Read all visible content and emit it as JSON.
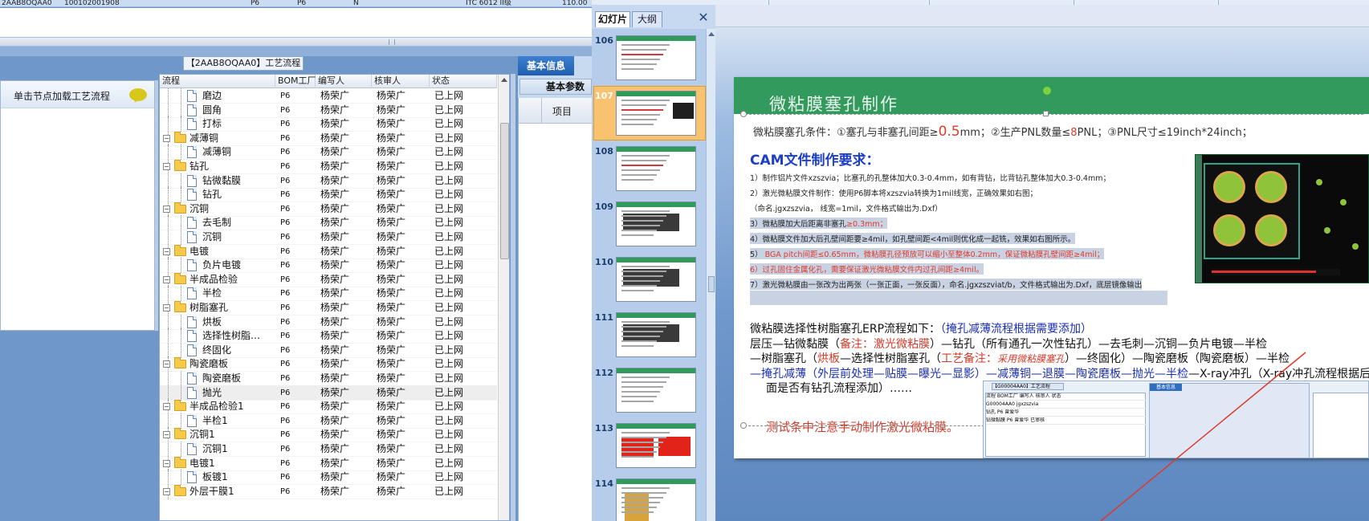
{
  "top_row": {
    "col1": "2AAB8OQAA0",
    "col2": "100102001908",
    "col3": "P6",
    "col4": "P6",
    "col5": "N",
    "col6": "ITC 6012 II级",
    "col7": "110.00"
  },
  "erp": {
    "load_hint": "单击节点加载工艺流程",
    "flow_title": "【2AAB8OQAA0】工艺流程",
    "columns": [
      "流程",
      "BOM工厂",
      "编写人",
      "核审人",
      "状态"
    ],
    "rows": [
      {
        "name": "磨边",
        "type": "doc",
        "plant": "P6",
        "author": "杨荣广",
        "reviewer": "杨荣广",
        "status": "已上网"
      },
      {
        "name": "圆角",
        "type": "doc",
        "plant": "P6",
        "author": "杨荣广",
        "reviewer": "杨荣广",
        "status": "已上网"
      },
      {
        "name": "打标",
        "type": "doc",
        "plant": "P6",
        "author": "杨荣广",
        "reviewer": "杨荣广",
        "status": "已上网"
      },
      {
        "name": "减薄铜",
        "type": "folder",
        "plant": "P6",
        "author": "杨荣广",
        "reviewer": "杨荣广",
        "status": "已上网"
      },
      {
        "name": "减薄铜",
        "type": "doc",
        "plant": "P6",
        "author": "杨荣广",
        "reviewer": "杨荣广",
        "status": "已上网"
      },
      {
        "name": "钻孔",
        "type": "folder",
        "plant": "P6",
        "author": "杨荣广",
        "reviewer": "杨荣广",
        "status": "已上网"
      },
      {
        "name": "钻微黏膜",
        "type": "doc",
        "plant": "P6",
        "author": "杨荣广",
        "reviewer": "杨荣广",
        "status": "已上网"
      },
      {
        "name": "钻孔",
        "type": "doc",
        "plant": "P6",
        "author": "杨荣广",
        "reviewer": "杨荣广",
        "status": "已上网"
      },
      {
        "name": "沉铜",
        "type": "folder",
        "plant": "P6",
        "author": "杨荣广",
        "reviewer": "杨荣广",
        "status": "已上网"
      },
      {
        "name": "去毛制",
        "type": "doc",
        "plant": "P6",
        "author": "杨荣广",
        "reviewer": "杨荣广",
        "status": "已上网"
      },
      {
        "name": "沉铜",
        "type": "doc",
        "plant": "P6",
        "author": "杨荣广",
        "reviewer": "杨荣广",
        "status": "已上网"
      },
      {
        "name": "电镀",
        "type": "folder",
        "plant": "P6",
        "author": "杨荣广",
        "reviewer": "杨荣广",
        "status": "已上网"
      },
      {
        "name": "负片电镀",
        "type": "doc",
        "plant": "P6",
        "author": "杨荣广",
        "reviewer": "杨荣广",
        "status": "已上网"
      },
      {
        "name": "半成品检验",
        "type": "folder",
        "plant": "P6",
        "author": "杨荣广",
        "reviewer": "杨荣广",
        "status": "已上网"
      },
      {
        "name": "半检",
        "type": "doc",
        "plant": "P6",
        "author": "杨荣广",
        "reviewer": "杨荣广",
        "status": "已上网"
      },
      {
        "name": "树脂塞孔",
        "type": "folder",
        "plant": "P6",
        "author": "杨荣广",
        "reviewer": "杨荣广",
        "status": "已上网"
      },
      {
        "name": "烘板",
        "type": "doc",
        "plant": "P6",
        "author": "杨荣广",
        "reviewer": "杨荣广",
        "status": "已上网"
      },
      {
        "name": "选择性树脂…",
        "type": "doc",
        "plant": "P6",
        "author": "杨荣广",
        "reviewer": "杨荣广",
        "status": "已上网"
      },
      {
        "name": "终固化",
        "type": "doc",
        "plant": "P6",
        "author": "杨荣广",
        "reviewer": "杨荣广",
        "status": "已上网"
      },
      {
        "name": "陶瓷磨板",
        "type": "folder",
        "plant": "P6",
        "author": "杨荣广",
        "reviewer": "杨荣广",
        "status": "已上网"
      },
      {
        "name": "陶瓷磨板",
        "type": "doc",
        "plant": "P6",
        "author": "杨荣广",
        "reviewer": "杨荣广",
        "status": "已上网"
      },
      {
        "name": "抛光",
        "type": "doc",
        "plant": "P6",
        "author": "杨荣广",
        "reviewer": "杨荣广",
        "status": "已上网",
        "selected": true
      },
      {
        "name": "半成品检验1",
        "type": "folder",
        "plant": "P6",
        "author": "杨荣广",
        "reviewer": "杨荣广",
        "status": "已上网"
      },
      {
        "name": "半检1",
        "type": "doc",
        "plant": "P6",
        "author": "杨荣广",
        "reviewer": "杨荣广",
        "status": "已上网"
      },
      {
        "name": "沉铜1",
        "type": "folder",
        "plant": "P6",
        "author": "杨荣广",
        "reviewer": "杨荣广",
        "status": "已上网"
      },
      {
        "name": "沉铜1",
        "type": "doc",
        "plant": "P6",
        "author": "杨荣广",
        "reviewer": "杨荣广",
        "status": "已上网"
      },
      {
        "name": "电镀1",
        "type": "folder",
        "plant": "P6",
        "author": "杨荣广",
        "reviewer": "杨荣广",
        "status": "已上网"
      },
      {
        "name": "板镀1",
        "type": "doc",
        "plant": "P6",
        "author": "杨荣广",
        "reviewer": "杨荣广",
        "status": "已上网"
      },
      {
        "name": "外层干膜1",
        "type": "folder",
        "plant": "P6",
        "author": "杨荣广",
        "reviewer": "杨荣广",
        "status": "已上网"
      }
    ],
    "info_tab": "基本信息",
    "param_tab": "基本参数",
    "param_col": "项目"
  },
  "ppt": {
    "tab_slides": "幻灯片",
    "tab_outline": "大纲",
    "close_glyph": "✕",
    "thumb_numbers": [
      "106",
      "107",
      "108",
      "109",
      "110",
      "111",
      "112",
      "113",
      "114"
    ],
    "selected_thumb": "107",
    "slide": {
      "title": "微粘膜塞孔制作",
      "cond_prefix": "微粘膜塞孔条件：①塞孔与非塞孔间距≥",
      "cond_big": "0.5",
      "cond_mid": "mm；②生产PNL数量≤",
      "cond_red": "8",
      "cond_suffix": "PNL；③PNL尺寸≤19inch*24inch；",
      "cam_title": "CAM文件制作要求：",
      "line1": "1）制作铝片文件xzszvia；比塞孔的孔整体加大0.3-0.4mm，如有背钻，比背钻孔整体加大0.3-0.4mm；",
      "line2": "2）激光微粘膜文件制作：使用P6脚本将xzszvia转换为1mil线宽，正确效果如右图；",
      "line2b": "（命名.jgxzszvia， 线宽=1mil，文件格式输出为.Dxf）",
      "line3a": "3）微粘膜加大后距离非塞孔",
      "line3b": "≥0.3mm；",
      "line4": "4）微粘膜文件加大后孔壁间距要≥4mil，如孔壁间距<4mil则优化成一起铣，效果如右图所示。",
      "line5a": "5） ",
      "line5b": "BGA pitch间距≤0.65mm，微粘膜孔径预放可以缩小至整体0.2mm，保证微粘膜孔壁间距≥4mil；",
      "line6": "6）过孔固住金属化孔，需要保证激光微粘膜文件内过孔间距≥4mil。",
      "line7": "7）激光微粘膜由一张改为出两张（一张正面，一张反面），命名.jgxzszviat/b，文件格式输出为.Dxf，底层镜像输出",
      "flow_intro": "微粘膜选择性树脂塞孔ERP流程如下：",
      "flow_intro_note": "（掩孔减薄流程根据需要添加）",
      "flow1a": "层压—钻微黏膜（",
      "flow1b": "备注：激光微粘膜",
      "flow1c": "）—钻孔（所有通孔一次性钻孔）—去毛刺—沉铜—负片电镀—半检",
      "flow2a": "—树脂塞孔（",
      "flow2b": "烘板",
      "flow2c": "—选择性树脂塞孔（",
      "flow2d": "工艺备注：",
      "flow2e": "采用微粘膜塞孔",
      "flow2f": "）—终固化）—陶瓷磨板（陶瓷磨板）—半检",
      "flow3a": "—掩孔减薄（外层前处理—贴膜—曝光—显影）—减薄铜—退膜—陶瓷磨板—抛光—半检",
      "flow3b": "—X-ray冲孔（X-ray冲孔流程根据后",
      "flow4": "面是否有钻孔流程添加）……",
      "test_note": "测试条中注意手动制作激光微粘膜。"
    },
    "embedded_shot": {
      "title": "【G00004AA0】工艺流程",
      "rows": [
        "流程   BOM工厂  编写人  核审人  状态",
        "G00004AA0 jgxzszvia",
        "钻孔    P6   曾爱华",
        "钻微黏膜  P6   曾爱华      已审核"
      ],
      "right_tab": "基本信息"
    }
  }
}
